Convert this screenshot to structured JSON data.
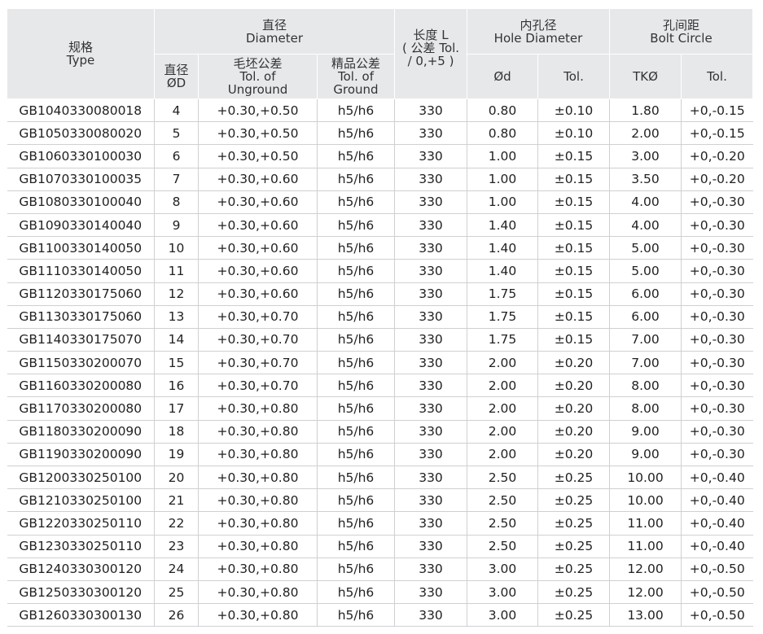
{
  "headers": {
    "type": "规格\nType",
    "diameter": "直径\nDiameter",
    "length": "长度 L\n( 公差 Tol.\n/ 0,+5 )",
    "hole_diameter": "内孔径\nHole Diameter",
    "bolt_circle": "孔间距\nBolt Circle",
    "od": "直径\nØD",
    "unground": "毛坯公差\nTol. of\nUnground",
    "ground": "精品公差\nTol. of\nGround",
    "od_small": "Ød",
    "hole_tol": "Tol.",
    "tk": "TKØ",
    "bolt_tol": "Tol."
  },
  "rows": [
    [
      "GB1040330080018",
      "4",
      "+0.30,+0.50",
      "h5/h6",
      "330",
      "0.80",
      "±0.10",
      "1.80",
      "+0,-0.15"
    ],
    [
      "GB1050330080020",
      "5",
      "+0.30,+0.50",
      "h5/h6",
      "330",
      "0.80",
      "±0.10",
      "2.00",
      "+0,-0.15"
    ],
    [
      "GB1060330100030",
      "6",
      "+0.30,+0.50",
      "h5/h6",
      "330",
      "1.00",
      "±0.15",
      "3.00",
      "+0,-0.20"
    ],
    [
      "GB1070330100035",
      "7",
      "+0.30,+0.60",
      "h5/h6",
      "330",
      "1.00",
      "±0.15",
      "3.50",
      "+0,-0.20"
    ],
    [
      "GB1080330100040",
      "8",
      "+0.30,+0.60",
      "h5/h6",
      "330",
      "1.00",
      "±0.15",
      "4.00",
      "+0,-0.30"
    ],
    [
      "GB1090330140040",
      "9",
      "+0.30,+0.60",
      "h5/h6",
      "330",
      "1.40",
      "±0.15",
      "4.00",
      "+0,-0.30"
    ],
    [
      "GB1100330140050",
      "10",
      "+0.30,+0.60",
      "h5/h6",
      "330",
      "1.40",
      "±0.15",
      "5.00",
      "+0,-0.30"
    ],
    [
      "GB1110330140050",
      "11",
      "+0.30,+0.60",
      "h5/h6",
      "330",
      "1.40",
      "±0.15",
      "5.00",
      "+0,-0.30"
    ],
    [
      "GB1120330175060",
      "12",
      "+0.30,+0.60",
      "h5/h6",
      "330",
      "1.75",
      "±0.15",
      "6.00",
      "+0,-0.30"
    ],
    [
      "GB1130330175060",
      "13",
      "+0.30,+0.70",
      "h5/h6",
      "330",
      "1.75",
      "±0.15",
      "6.00",
      "+0,-0.30"
    ],
    [
      "GB1140330175070",
      "14",
      "+0.30,+0.70",
      "h5/h6",
      "330",
      "1.75",
      "±0.15",
      "7.00",
      "+0,-0.30"
    ],
    [
      "GB1150330200070",
      "15",
      "+0.30,+0.70",
      "h5/h6",
      "330",
      "2.00",
      "±0.20",
      "7.00",
      "+0,-0.30"
    ],
    [
      "GB1160330200080",
      "16",
      "+0.30,+0.70",
      "h5/h6",
      "330",
      "2.00",
      "±0.20",
      "8.00",
      "+0,-0.30"
    ],
    [
      "GB1170330200080",
      "17",
      "+0.30,+0.80",
      "h5/h6",
      "330",
      "2.00",
      "±0.20",
      "8.00",
      "+0,-0.30"
    ],
    [
      "GB1180330200090",
      "18",
      "+0.30,+0.80",
      "h5/h6",
      "330",
      "2.00",
      "±0.20",
      "9.00",
      "+0,-0.30"
    ],
    [
      "GB1190330200090",
      "19",
      "+0.30,+0.80",
      "h5/h6",
      "330",
      "2.00",
      "±0.20",
      "9.00",
      "+0,-0.30"
    ],
    [
      "GB1200330250100",
      "20",
      "+0.30,+0.80",
      "h5/h6",
      "330",
      "2.50",
      "±0.25",
      "10.00",
      "+0,-0.40"
    ],
    [
      "GB1210330250100",
      "21",
      "+0.30,+0.80",
      "h5/h6",
      "330",
      "2.50",
      "±0.25",
      "10.00",
      "+0,-0.40"
    ],
    [
      "GB1220330250110",
      "22",
      "+0.30,+0.80",
      "h5/h6",
      "330",
      "2.50",
      "±0.25",
      "11.00",
      "+0,-0.40"
    ],
    [
      "GB1230330250110",
      "23",
      "+0.30,+0.80",
      "h5/h6",
      "330",
      "2.50",
      "±0.25",
      "11.00",
      "+0,-0.40"
    ],
    [
      "GB1240330300120",
      "24",
      "+0.30,+0.80",
      "h5/h6",
      "330",
      "3.00",
      "±0.25",
      "12.00",
      "+0,-0.50"
    ],
    [
      "GB1250330300120",
      "25",
      "+0.30,+0.80",
      "h5/h6",
      "330",
      "3.00",
      "±0.25",
      "12.00",
      "+0,-0.50"
    ],
    [
      "GB1260330300130",
      "26",
      "+0.30,+0.80",
      "h5/h6",
      "330",
      "3.00",
      "±0.25",
      "13.00",
      "+0,-0.50"
    ]
  ]
}
